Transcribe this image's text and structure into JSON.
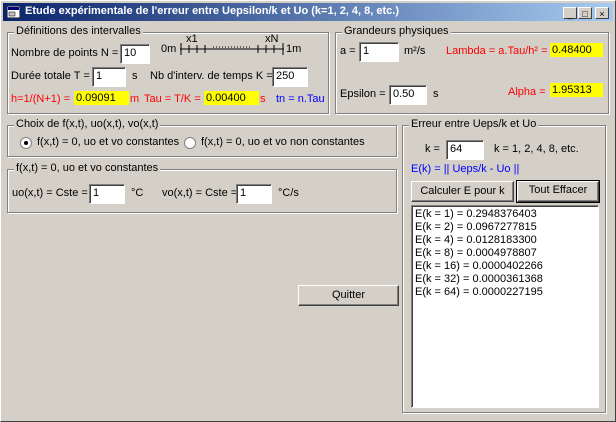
{
  "window": {
    "title": "Etude expérimentale de l'erreur entre Uepsilon/k et Uo (k=1, 2, 4, 8,  etc.)",
    "controls": [
      "_",
      "□",
      "×"
    ]
  },
  "definitions": {
    "group_label": "Définitions des intervalles",
    "n_label": "Nombre de points  N =",
    "n_value": "10",
    "scale_0m": "0m",
    "scale_x1": "x1",
    "scale_xN": "xN",
    "scale_1m": "1m",
    "t_label": "Durée totale T =",
    "t_value": "1",
    "t_unit": "s",
    "k_label": "Nb d'interv. de temps K =",
    "k_value": "250",
    "h_label": "h=1/(N+1) =",
    "h_value": "0.09091",
    "h_unit": "m",
    "tau_label": "Tau = T/K =",
    "tau_value": "0.00400",
    "tau_unit": "s",
    "tn_label": "tn = n.Tau"
  },
  "physics": {
    "group_label": "Grandeurs physiques",
    "a_label": "a =",
    "a_value": "1",
    "a_unit": "m²/s",
    "lambda_label": "Lambda = a.Tau/h² =",
    "lambda_value": "0.48400",
    "epsilon_label": "Epsilon =",
    "epsilon_value": "0.50",
    "epsilon_unit": "s",
    "alpha_label": "Alpha =",
    "alpha_value": "1.95313"
  },
  "choice": {
    "group_label": "Choix de f(x,t), uo(x,t), vo(x,t)",
    "option1": "f(x,t) = 0, uo et vo constantes",
    "option2": "f(x,t) = 0, uo et vo non constantes",
    "selected": 1
  },
  "constants": {
    "group_label": "f(x,t) = 0, uo et vo constantes",
    "uo_label": "uo(x,t) = Cste =",
    "uo_value": "1",
    "uo_unit": "°C",
    "vo_label": "vo(x,t) = Cste =",
    "vo_value": "1",
    "vo_unit": "°C/s"
  },
  "quit_button": "Quitter",
  "error": {
    "group_label": "Erreur entre Ueps/k et Uo",
    "k_label": "k =",
    "k_value": "64",
    "k_hint": "k = 1, 2, 4, 8, etc.",
    "formula": "E(k) = || Ueps/k - Uo ||",
    "compute_button": "Calculer E pour k",
    "clear_button": "Tout Effacer",
    "results": [
      "E(k = 1) = 0.2948376403",
      "E(k = 2) = 0.0967277815",
      "E(k = 4) = 0.0128183300",
      "E(k = 8) = 0.0004978807",
      "E(k = 16) = 0.0000402266",
      "E(k = 32) = 0.0000361368",
      "E(k = 64) = 0.0000227195"
    ]
  },
  "colors": {
    "title_start": "#0a246a",
    "title_end": "#a6caf0",
    "highlight": "#ffff00",
    "red_text": "#ff0000",
    "blue_text": "#0000ff"
  }
}
